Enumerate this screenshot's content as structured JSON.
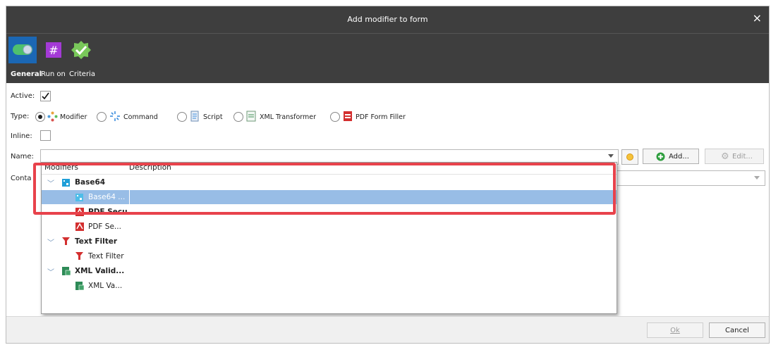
{
  "window": {
    "title": "Add modifier to form",
    "close_symbol": "×"
  },
  "tabs": [
    {
      "label": "General",
      "icon": "toggle-icon",
      "active": true
    },
    {
      "label": "Run on",
      "icon": "hash-icon",
      "active": false
    },
    {
      "label": "Criteria",
      "icon": "checkmark-badge-icon",
      "active": false
    }
  ],
  "form": {
    "active": {
      "label": "Active:",
      "checked": true
    },
    "type": {
      "label": "Type:",
      "options": [
        {
          "label": "Modifier",
          "selected": true
        },
        {
          "label": "Command",
          "selected": false
        },
        {
          "label": "Script",
          "selected": false
        },
        {
          "label": "XML Transformer",
          "selected": false
        },
        {
          "label": "PDF Form Filler",
          "selected": false
        }
      ]
    },
    "inline": {
      "label": "Inline:",
      "checked": false
    },
    "name": {
      "label": "Name:",
      "value": ""
    },
    "container": {
      "label": "Conta"
    }
  },
  "buttons": {
    "add": "Add...",
    "edit": "Edit...",
    "ok": "Ok",
    "cancel": "Cancel"
  },
  "dropdown": {
    "columns": [
      "Modifiers",
      "Description"
    ],
    "rows": [
      {
        "text": "Base64",
        "group": true
      },
      {
        "text": "Base64 ...",
        "group": false,
        "selected": true
      },
      {
        "text": "PDF Secu...",
        "group": true
      },
      {
        "text": "PDF Se...",
        "group": false
      },
      {
        "text": "Text Filter",
        "group": true
      },
      {
        "text": "Text Filter",
        "group": false
      },
      {
        "text": "XML Valid...",
        "group": true
      },
      {
        "text": "XML Va...",
        "group": false
      }
    ]
  },
  "colors": {
    "titlebar": "#3e3e3e",
    "general_tab": "#1b67b4",
    "selection": "#98bde6",
    "highlight": "#e8424b"
  }
}
